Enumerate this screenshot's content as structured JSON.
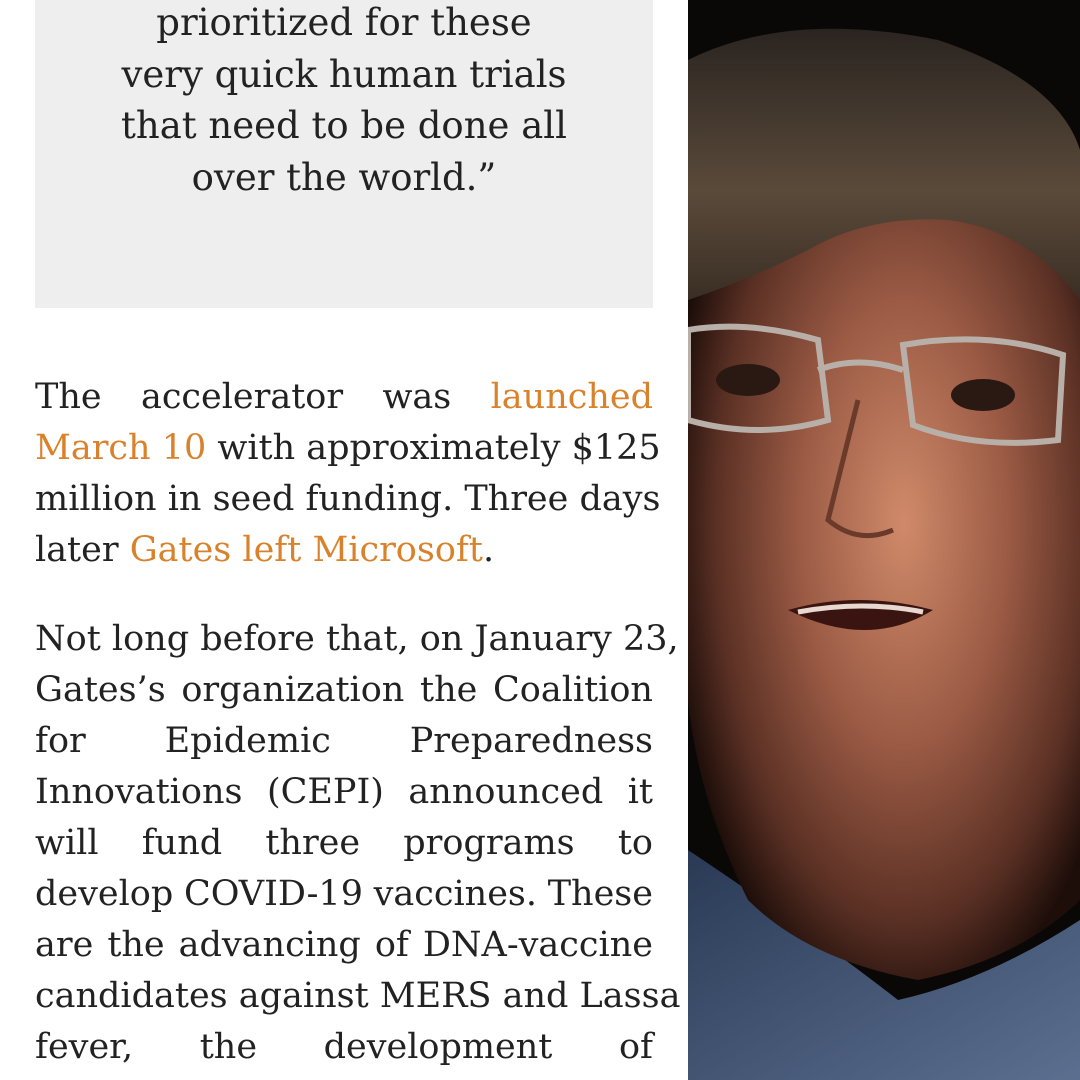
{
  "quote": {
    "lines": [
      "prioritized for these",
      "very quick human trials",
      "that need to be done all",
      "over the world.”"
    ]
  },
  "paragraph1": {
    "line1": [
      "The",
      "accelerator",
      "was",
      "launched"
    ],
    "line2_link": "March 10",
    "line2_rest": " with approximately $125",
    "line3": "million in seed funding. Three days",
    "line4_pre": "later ",
    "line4_link": "Gates left Microsoft",
    "line4_post": "."
  },
  "paragraph2": {
    "lines": [
      [
        "Not long before that, on January 23,"
      ],
      [
        "Gates’s",
        "organization",
        "the",
        "Coalition"
      ],
      [
        "for",
        "Epidemic",
        "Preparedness"
      ],
      [
        "Innovations",
        "(CEPI)",
        "announced",
        "it"
      ],
      [
        "will",
        "fund",
        "three",
        "programs",
        "to"
      ],
      [
        "develop",
        "COVID-19",
        "vaccines.",
        "These"
      ],
      [
        "are",
        "the",
        "advancing",
        "of",
        "DNA-vaccine"
      ],
      [
        "candidates against MERS and Lassa"
      ],
      [
        "fever,",
        "the",
        "development",
        "of"
      ]
    ]
  },
  "colors": {
    "link": "#d9822b",
    "text": "#222222",
    "quote_bg": "#eeeeee"
  },
  "photo": {
    "icon": "portrait-photo"
  }
}
